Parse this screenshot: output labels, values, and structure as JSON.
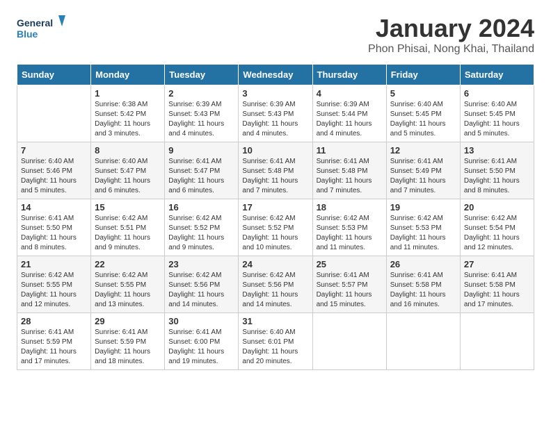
{
  "header": {
    "logo_line1": "General",
    "logo_line2": "Blue",
    "title": "January 2024",
    "subtitle": "Phon Phisai, Nong Khai, Thailand"
  },
  "days_of_week": [
    "Sunday",
    "Monday",
    "Tuesday",
    "Wednesday",
    "Thursday",
    "Friday",
    "Saturday"
  ],
  "weeks": [
    [
      {
        "day": "",
        "content": ""
      },
      {
        "day": "1",
        "content": "Sunrise: 6:38 AM\nSunset: 5:42 PM\nDaylight: 11 hours\nand 3 minutes."
      },
      {
        "day": "2",
        "content": "Sunrise: 6:39 AM\nSunset: 5:43 PM\nDaylight: 11 hours\nand 4 minutes."
      },
      {
        "day": "3",
        "content": "Sunrise: 6:39 AM\nSunset: 5:43 PM\nDaylight: 11 hours\nand 4 minutes."
      },
      {
        "day": "4",
        "content": "Sunrise: 6:39 AM\nSunset: 5:44 PM\nDaylight: 11 hours\nand 4 minutes."
      },
      {
        "day": "5",
        "content": "Sunrise: 6:40 AM\nSunset: 5:45 PM\nDaylight: 11 hours\nand 5 minutes."
      },
      {
        "day": "6",
        "content": "Sunrise: 6:40 AM\nSunset: 5:45 PM\nDaylight: 11 hours\nand 5 minutes."
      }
    ],
    [
      {
        "day": "7",
        "content": "Sunrise: 6:40 AM\nSunset: 5:46 PM\nDaylight: 11 hours\nand 5 minutes."
      },
      {
        "day": "8",
        "content": "Sunrise: 6:40 AM\nSunset: 5:47 PM\nDaylight: 11 hours\nand 6 minutes."
      },
      {
        "day": "9",
        "content": "Sunrise: 6:41 AM\nSunset: 5:47 PM\nDaylight: 11 hours\nand 6 minutes."
      },
      {
        "day": "10",
        "content": "Sunrise: 6:41 AM\nSunset: 5:48 PM\nDaylight: 11 hours\nand 7 minutes."
      },
      {
        "day": "11",
        "content": "Sunrise: 6:41 AM\nSunset: 5:48 PM\nDaylight: 11 hours\nand 7 minutes."
      },
      {
        "day": "12",
        "content": "Sunrise: 6:41 AM\nSunset: 5:49 PM\nDaylight: 11 hours\nand 7 minutes."
      },
      {
        "day": "13",
        "content": "Sunrise: 6:41 AM\nSunset: 5:50 PM\nDaylight: 11 hours\nand 8 minutes."
      }
    ],
    [
      {
        "day": "14",
        "content": "Sunrise: 6:41 AM\nSunset: 5:50 PM\nDaylight: 11 hours\nand 8 minutes."
      },
      {
        "day": "15",
        "content": "Sunrise: 6:42 AM\nSunset: 5:51 PM\nDaylight: 11 hours\nand 9 minutes."
      },
      {
        "day": "16",
        "content": "Sunrise: 6:42 AM\nSunset: 5:52 PM\nDaylight: 11 hours\nand 9 minutes."
      },
      {
        "day": "17",
        "content": "Sunrise: 6:42 AM\nSunset: 5:52 PM\nDaylight: 11 hours\nand 10 minutes."
      },
      {
        "day": "18",
        "content": "Sunrise: 6:42 AM\nSunset: 5:53 PM\nDaylight: 11 hours\nand 11 minutes."
      },
      {
        "day": "19",
        "content": "Sunrise: 6:42 AM\nSunset: 5:53 PM\nDaylight: 11 hours\nand 11 minutes."
      },
      {
        "day": "20",
        "content": "Sunrise: 6:42 AM\nSunset: 5:54 PM\nDaylight: 11 hours\nand 12 minutes."
      }
    ],
    [
      {
        "day": "21",
        "content": "Sunrise: 6:42 AM\nSunset: 5:55 PM\nDaylight: 11 hours\nand 12 minutes."
      },
      {
        "day": "22",
        "content": "Sunrise: 6:42 AM\nSunset: 5:55 PM\nDaylight: 11 hours\nand 13 minutes."
      },
      {
        "day": "23",
        "content": "Sunrise: 6:42 AM\nSunset: 5:56 PM\nDaylight: 11 hours\nand 14 minutes."
      },
      {
        "day": "24",
        "content": "Sunrise: 6:42 AM\nSunset: 5:56 PM\nDaylight: 11 hours\nand 14 minutes."
      },
      {
        "day": "25",
        "content": "Sunrise: 6:41 AM\nSunset: 5:57 PM\nDaylight: 11 hours\nand 15 minutes."
      },
      {
        "day": "26",
        "content": "Sunrise: 6:41 AM\nSunset: 5:58 PM\nDaylight: 11 hours\nand 16 minutes."
      },
      {
        "day": "27",
        "content": "Sunrise: 6:41 AM\nSunset: 5:58 PM\nDaylight: 11 hours\nand 17 minutes."
      }
    ],
    [
      {
        "day": "28",
        "content": "Sunrise: 6:41 AM\nSunset: 5:59 PM\nDaylight: 11 hours\nand 17 minutes."
      },
      {
        "day": "29",
        "content": "Sunrise: 6:41 AM\nSunset: 5:59 PM\nDaylight: 11 hours\nand 18 minutes."
      },
      {
        "day": "30",
        "content": "Sunrise: 6:41 AM\nSunset: 6:00 PM\nDaylight: 11 hours\nand 19 minutes."
      },
      {
        "day": "31",
        "content": "Sunrise: 6:40 AM\nSunset: 6:01 PM\nDaylight: 11 hours\nand 20 minutes."
      },
      {
        "day": "",
        "content": ""
      },
      {
        "day": "",
        "content": ""
      },
      {
        "day": "",
        "content": ""
      }
    ]
  ]
}
